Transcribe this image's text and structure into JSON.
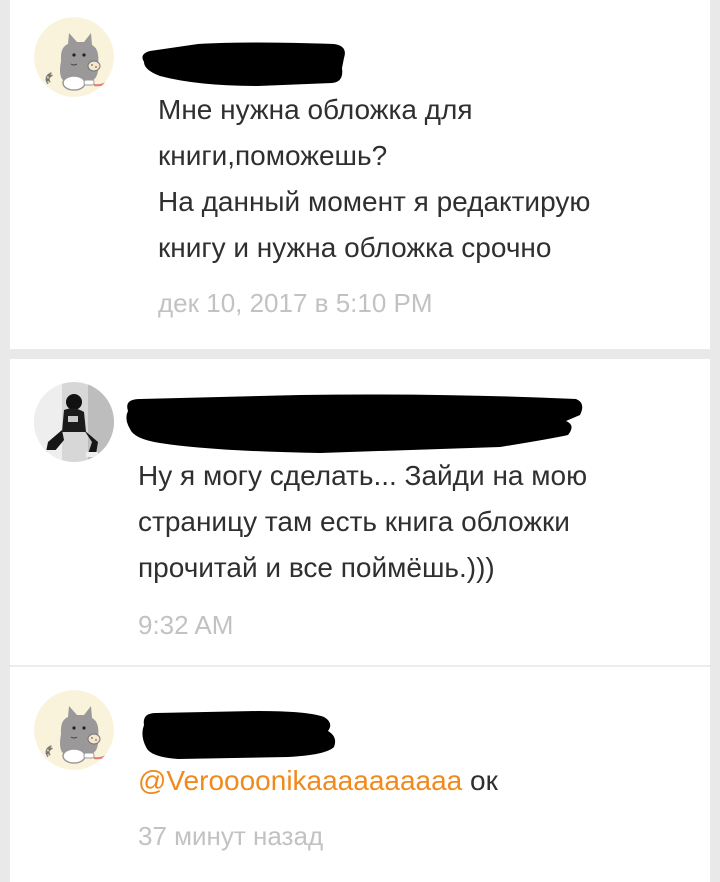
{
  "comments": [
    {
      "avatar": "pusheen-cat-avatar",
      "author_redacted": true,
      "text": "Мне нужна обложка для\nкниги,поможешь?\nНа данный момент я редактирую\nкнигу и нужна обложка срочно",
      "timestamp": "дек 10, 2017 в 5:10 PM"
    },
    {
      "avatar": "user-photo-avatar",
      "author_redacted": true,
      "text": "Ну я могу сделать... Зайди на мою\nстраницу там есть книга обложки\nпрочитай и все поймёшь.)))",
      "timestamp": "9:32 AM"
    },
    {
      "avatar": "pusheen-cat-avatar",
      "author_redacted": true,
      "mention": "@Veroooonikaaaaaaaaaa",
      "text": " ок",
      "timestamp": "37 минут назад"
    }
  ],
  "colors": {
    "mention": "#f2891b",
    "timestamp": "#c2c2c2",
    "text": "#2f2f2f",
    "background": "#e9e9e9"
  }
}
